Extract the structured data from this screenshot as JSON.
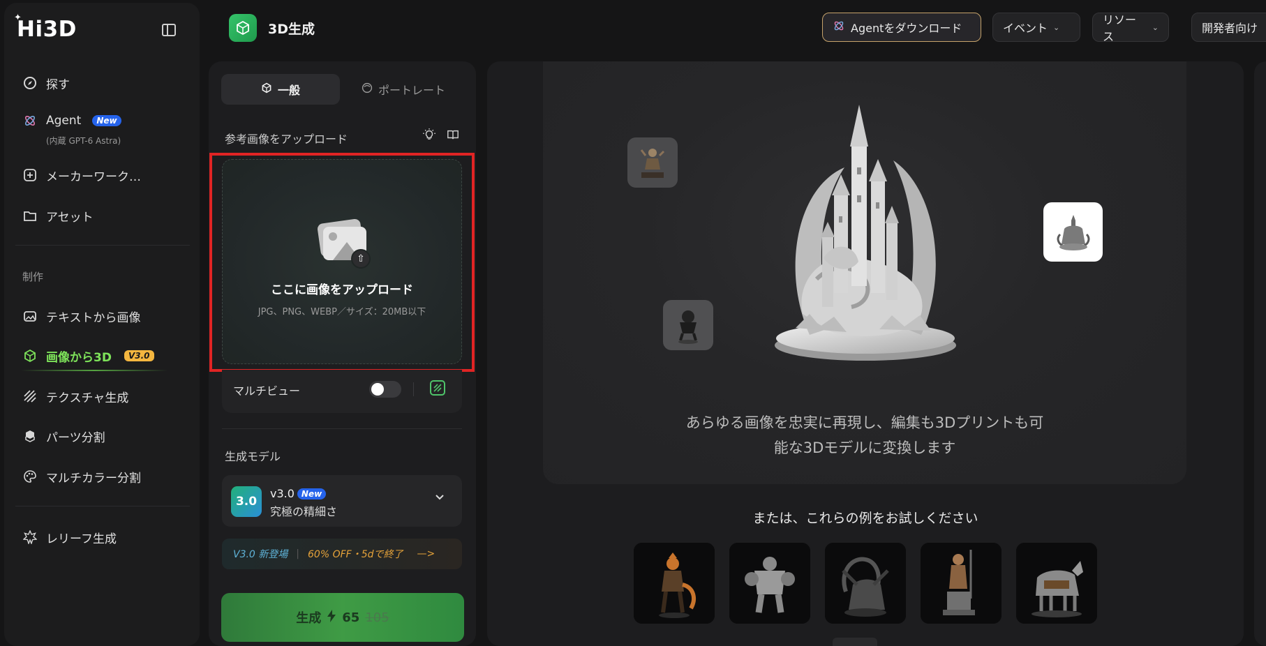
{
  "sidebar": {
    "logo": "Hi3D",
    "items": [
      {
        "label": "探す",
        "icon": "compass-icon"
      },
      {
        "label": "Agent",
        "badge": "New",
        "sub": "(内蔵 GPT-6 Astra)",
        "icon": "atom-icon"
      },
      {
        "label": "メーカーワーク…",
        "icon": "plus-square-icon"
      },
      {
        "label": "アセット",
        "icon": "folder-icon"
      }
    ],
    "section_label": "制作",
    "create_items": [
      {
        "label": "テキストから画像",
        "icon": "image-sparkle-icon"
      },
      {
        "label": "画像から3D",
        "badge": "V3.0",
        "icon": "cube-icon",
        "active": true
      },
      {
        "label": "テクスチャ生成",
        "icon": "stripes-icon"
      },
      {
        "label": "パーツ分割",
        "icon": "blocks-icon"
      },
      {
        "label": "マルチカラー分割",
        "icon": "palette-icon"
      }
    ],
    "extra_items": [
      {
        "label": "レリーフ生成",
        "icon": "star-burst-icon"
      }
    ]
  },
  "header": {
    "title": "3D生成",
    "agent_download": "Agentをダウンロード",
    "event": "イベント",
    "resources": "リソース",
    "developers": "開発者向け"
  },
  "panel": {
    "tabs": [
      {
        "label": "一般",
        "active": true
      },
      {
        "label": "ポートレート",
        "active": false
      }
    ],
    "upload_label": "参考画像をアップロード",
    "dropzone_title": "ここに画像をアップロード",
    "dropzone_sub": "JPG、PNG、WEBP／サイズ：20MB以下",
    "multiview_label": "マルチビュー",
    "multiview_enabled": false,
    "model_label": "生成モデル",
    "model": {
      "badge": "3.0",
      "name": "v3.0",
      "tag": "New",
      "desc": "究極の精細さ"
    },
    "promo": {
      "left": "V3.0 新登場",
      "right": "60% OFF・5dで終了",
      "arrow": "—>"
    },
    "generate": {
      "label": "生成",
      "cost": "65",
      "old_cost": "105"
    }
  },
  "main": {
    "hero_line1": "あらゆる画像を忠実に再現し、編集も3Dプリントも可",
    "hero_line2": "能な3Dモデルに変換します",
    "examples_title": "または、これらの例をお試しください",
    "examples": [
      {
        "name": "fox-warrior"
      },
      {
        "name": "stone-golem"
      },
      {
        "name": "dragon"
      },
      {
        "name": "knight-statue"
      },
      {
        "name": "armored-wolf"
      }
    ]
  },
  "colors": {
    "accent_green": "#7ee35a",
    "highlight_red": "#e02424",
    "badge_blue": "#2563eb",
    "badge_gold": "#f4b63f",
    "promo_orange": "#e6a33a"
  }
}
